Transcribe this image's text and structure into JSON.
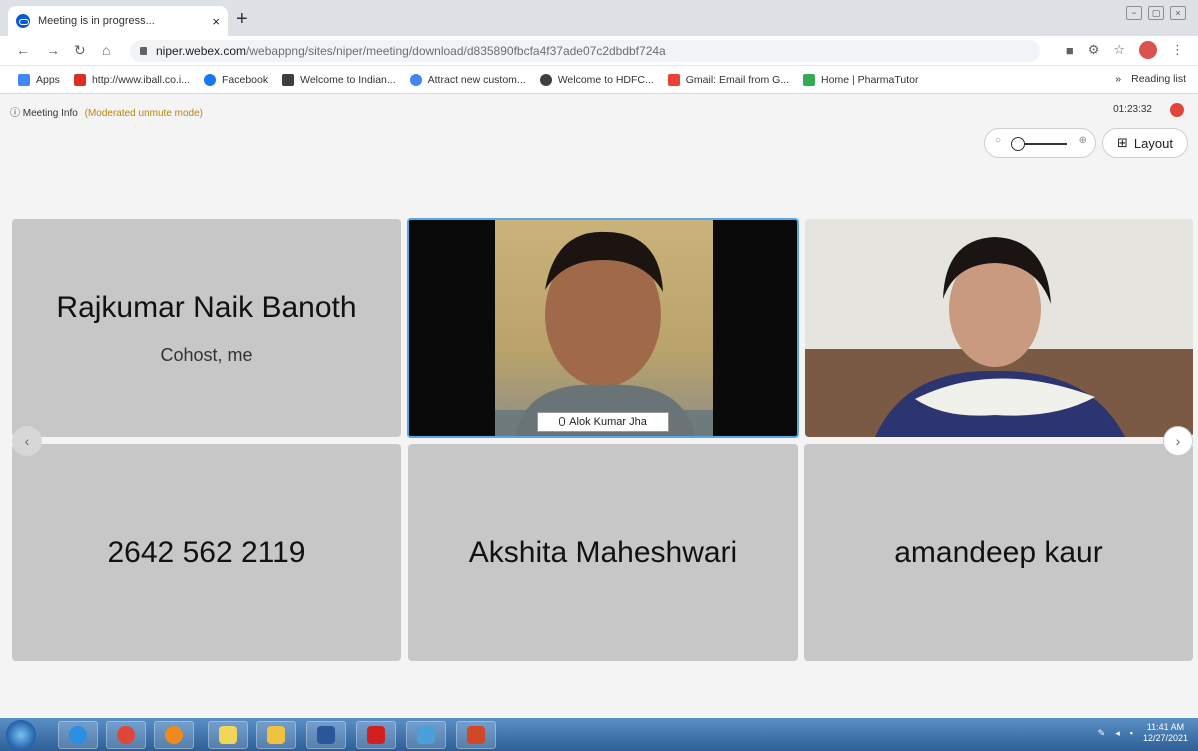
{
  "browser": {
    "tab_title": "Meeting is in progress...",
    "tab_close": "×",
    "new_tab": "+",
    "url_host": "niper.webex.com",
    "url_path": "/webappng/sites/niper/meeting/download/d835890fbcfa4f37ade07c2dbdbf724a",
    "bookmarks": [
      {
        "label": "Apps",
        "color": "#5f6368"
      },
      {
        "label": "http://www.iball.co.i...",
        "color": "#d93025"
      },
      {
        "label": "Facebook",
        "color": "#1877f2"
      },
      {
        "label": "Welcome to Indian...",
        "color": "#3c4043"
      },
      {
        "label": "Attract new custom...",
        "color": "#4285f4"
      },
      {
        "label": "Welcome to HDFC...",
        "color": "#3c4043"
      },
      {
        "label": "Gmail: Email from G...",
        "color": "#ea4335"
      },
      {
        "label": "Home | PharmaTutor",
        "color": "#34a853"
      }
    ],
    "reading_list": "Reading list",
    "overflow": "»"
  },
  "meeting": {
    "info_label": "Meeting Info",
    "mode_label": "(Moderated unmute mode)",
    "timer": "01:23:32",
    "layout_label": "Layout",
    "zoom_minus": "○",
    "zoom_plus": "⊕"
  },
  "participants": [
    {
      "name": "Rajkumar Naik Banoth",
      "subtitle": "Cohost, me",
      "type": "placeholder"
    },
    {
      "name": "Alok Kumar Jha",
      "type": "video",
      "active": true
    },
    {
      "name": "",
      "type": "video"
    },
    {
      "name": "2642 562 2119",
      "type": "placeholder"
    },
    {
      "name": "Akshita Maheshwari",
      "type": "placeholder"
    },
    {
      "name": "amandeep kaur",
      "type": "placeholder"
    }
  ],
  "taskbar": {
    "time": "11:41 AM",
    "date": "12/27/2021",
    "items": [
      {
        "icon": "internet-explorer-icon",
        "color": "#2a8fe0"
      },
      {
        "icon": "chrome-icon",
        "color": "#e0453a"
      },
      {
        "icon": "media-player-icon",
        "color": "#f08a1c"
      },
      {
        "icon": "sticky-notes-icon",
        "color": "#f2d65a"
      },
      {
        "icon": "folder-icon",
        "color": "#f0c040"
      },
      {
        "icon": "word-icon",
        "color": "#2b579a"
      },
      {
        "icon": "acrobat-icon",
        "color": "#d21f1f"
      },
      {
        "icon": "network-icon",
        "color": "#4aa0d8"
      },
      {
        "icon": "powerpoint-icon",
        "color": "#d24726"
      }
    ]
  }
}
